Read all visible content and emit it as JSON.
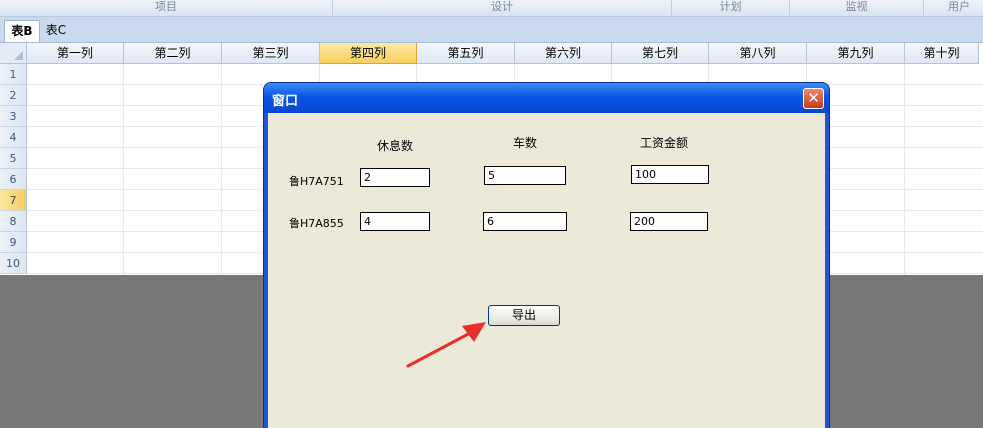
{
  "ribbon": {
    "groups": [
      "项目",
      "设计",
      "计划",
      "监视",
      "用户"
    ]
  },
  "sheet_tabs": [
    {
      "label": "表B",
      "active": true
    },
    {
      "label": "表C",
      "active": false
    }
  ],
  "grid": {
    "columns": [
      "第一列",
      "第二列",
      "第三列",
      "第四列",
      "第五列",
      "第六列",
      "第七列",
      "第八列",
      "第九列",
      "第十列"
    ],
    "selected_column": "第四列",
    "rows": [
      "1",
      "2",
      "3",
      "4",
      "5",
      "6",
      "7",
      "8",
      "9",
      "10"
    ],
    "selected_row": "7"
  },
  "dialog": {
    "title": "窗口",
    "close_glyph": "✕",
    "headers": {
      "rest_days": "休息数",
      "car_count": "车数",
      "wage_amount": "工资金额"
    },
    "records": [
      {
        "plate": "鲁H7A751",
        "rest_days": "2",
        "car_count": "5",
        "wage_amount": "100"
      },
      {
        "plate": "鲁H7A855",
        "rest_days": "4",
        "car_count": "6",
        "wage_amount": "200"
      }
    ],
    "export_label": "导出"
  },
  "annotation": {
    "color": "#e8302a"
  }
}
